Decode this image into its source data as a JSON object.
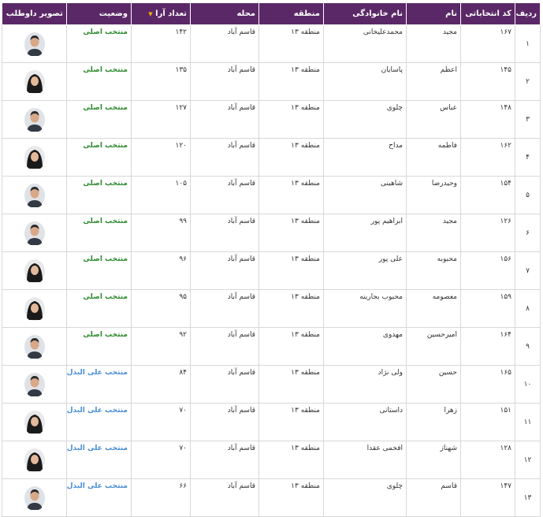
{
  "headers": {
    "index": "ردیف",
    "code": "کد انتخاباتی",
    "first_name": "نام",
    "last_name": "نام خانوادگی",
    "region": "منطقه",
    "neighborhood": "محله",
    "votes": "تعداد آرا",
    "status": "وضعیت",
    "photo": "تصویر داوطلب"
  },
  "votes_sort_icon": "sort-down-icon",
  "status_colors": {
    "main": "#2f8a2f",
    "alternate": "#4a8fd6"
  },
  "rows": [
    {
      "index": "۱",
      "code": "۱۶۷",
      "first_name": "مجید",
      "last_name": "محمدعلیخانی",
      "region": "منطقه ۱۳",
      "neighborhood": "قاسم آباد",
      "votes": "۱۴۲",
      "status": "منتخب اصلی",
      "status_type": "main",
      "gender": "m"
    },
    {
      "index": "۲",
      "code": "۱۴۵",
      "first_name": "اعظم",
      "last_name": "پاسایان",
      "region": "منطقه ۱۳",
      "neighborhood": "قاسم آباد",
      "votes": "۱۳۵",
      "status": "منتخب اصلی",
      "status_type": "main",
      "gender": "f"
    },
    {
      "index": "۳",
      "code": "۱۴۸",
      "first_name": "عباس",
      "last_name": "چلوی",
      "region": "منطقه ۱۳",
      "neighborhood": "قاسم آباد",
      "votes": "۱۲۷",
      "status": "منتخب اصلی",
      "status_type": "main",
      "gender": "m"
    },
    {
      "index": "۴",
      "code": "۱۶۲",
      "first_name": "فاطمه",
      "last_name": "مداح",
      "region": "منطقه ۱۳",
      "neighborhood": "قاسم آباد",
      "votes": "۱۲۰",
      "status": "منتخب اصلی",
      "status_type": "main",
      "gender": "f"
    },
    {
      "index": "۵",
      "code": "۱۵۴",
      "first_name": "وحیدرضا",
      "last_name": "شاهینی",
      "region": "منطقه ۱۳",
      "neighborhood": "قاسم آباد",
      "votes": "۱۰۵",
      "status": "منتخب اصلی",
      "status_type": "main",
      "gender": "m"
    },
    {
      "index": "۶",
      "code": "۱۲۶",
      "first_name": "مجید",
      "last_name": "ابراهیم پور",
      "region": "منطقه ۱۳",
      "neighborhood": "قاسم آباد",
      "votes": "۹۹",
      "status": "منتخب اصلی",
      "status_type": "main",
      "gender": "m"
    },
    {
      "index": "۷",
      "code": "۱۵۶",
      "first_name": "محبوبه",
      "last_name": "علی پور",
      "region": "منطقه ۱۳",
      "neighborhood": "قاسم آباد",
      "votes": "۹۶",
      "status": "منتخب اصلی",
      "status_type": "main",
      "gender": "f"
    },
    {
      "index": "۸",
      "code": "۱۵۹",
      "first_name": "معصومه",
      "last_name": "محبوب بجارینه",
      "region": "منطقه ۱۳",
      "neighborhood": "قاسم آباد",
      "votes": "۹۵",
      "status": "منتخب اصلی",
      "status_type": "main",
      "gender": "f"
    },
    {
      "index": "۹",
      "code": "۱۶۴",
      "first_name": "امیرحسین",
      "last_name": "مهدوی",
      "region": "منطقه ۱۳",
      "neighborhood": "قاسم آباد",
      "votes": "۹۲",
      "status": "منتخب اصلی",
      "status_type": "main",
      "gender": "m"
    },
    {
      "index": "۱۰",
      "code": "۱۶۵",
      "first_name": "حسین",
      "last_name": "ولی نژاد",
      "region": "منطقه ۱۳",
      "neighborhood": "قاسم آباد",
      "votes": "۸۴",
      "status": "منتخب علی البدل",
      "status_type": "alternate",
      "gender": "m"
    },
    {
      "index": "۱۱",
      "code": "۱۵۱",
      "first_name": "زهرا",
      "last_name": "داستانی",
      "region": "منطقه ۱۳",
      "neighborhood": "قاسم آباد",
      "votes": "۷۰",
      "status": "منتخب علی البدل",
      "status_type": "alternate",
      "gender": "f"
    },
    {
      "index": "۱۲",
      "code": "۱۲۸",
      "first_name": "شهناز",
      "last_name": "افخمی عقدا",
      "region": "منطقه ۱۳",
      "neighborhood": "قاسم آباد",
      "votes": "۷۰",
      "status": "منتخب علی البدل",
      "status_type": "alternate",
      "gender": "f"
    },
    {
      "index": "۱۳",
      "code": "۱۴۷",
      "first_name": "قاسم",
      "last_name": "چلوی",
      "region": "منطقه ۱۳",
      "neighborhood": "قاسم آباد",
      "votes": "۶۶",
      "status": "منتخب علی البدل",
      "status_type": "alternate",
      "gender": "m"
    }
  ]
}
